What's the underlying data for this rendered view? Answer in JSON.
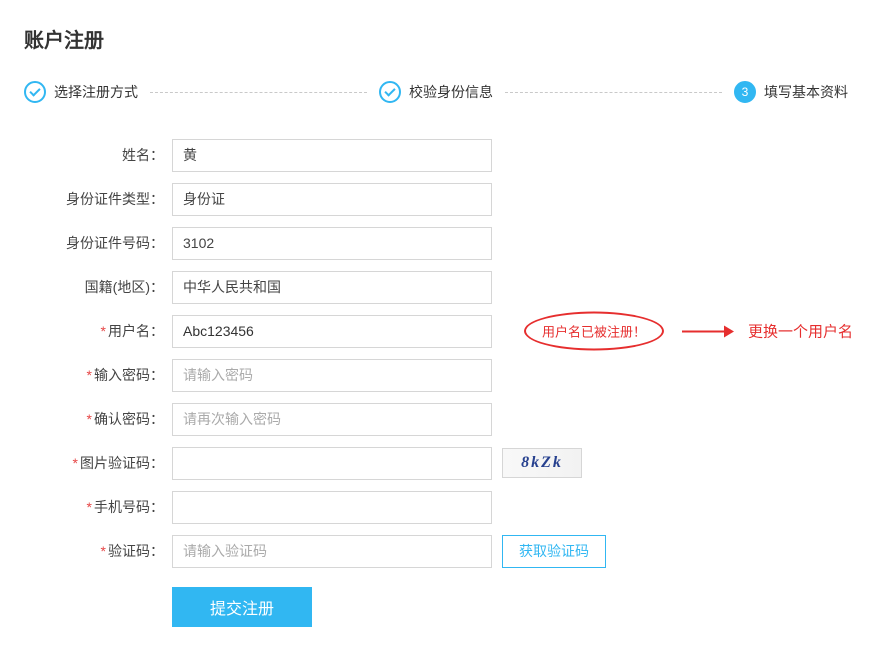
{
  "title": "账户注册",
  "steps": {
    "s1": "选择注册方式",
    "s2": "校验身份信息",
    "s3_num": "3",
    "s3": "填写基本资料"
  },
  "labels": {
    "name": "姓名：",
    "id_type": "身份证件类型：",
    "id_number": "身份证件号码：",
    "nationality": "国籍(地区)：",
    "username": "用户名：",
    "password": "输入密码：",
    "confirm_password": "确认密码：",
    "captcha": "图片验证码：",
    "phone": "手机号码：",
    "sms_code": "验证码："
  },
  "values": {
    "name": "黄",
    "id_type": "身份证",
    "id_number": "3102",
    "nationality": "中华人民共和国",
    "username": "Abc123456",
    "password": "",
    "confirm_password": "",
    "captcha": "",
    "phone": "",
    "sms_code": ""
  },
  "placeholders": {
    "password": "请输入密码",
    "confirm_password": "请再次输入密码",
    "sms_code": "请输入验证码"
  },
  "captcha_text": "8kZk",
  "get_code_label": "获取验证码",
  "submit_label": "提交注册",
  "error": {
    "msg": "用户名已被注册！",
    "hint": "更换一个用户名"
  }
}
